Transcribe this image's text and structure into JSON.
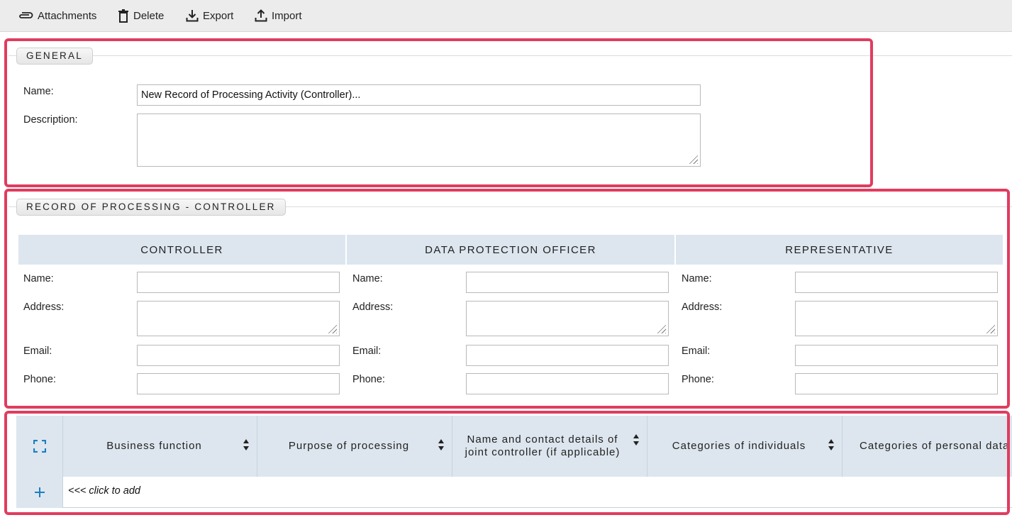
{
  "toolbar": {
    "attachments": "Attachments",
    "delete": "Delete",
    "export": "Export",
    "import": "Import"
  },
  "general": {
    "legend": "GENERAL",
    "name_label": "Name:",
    "name_value": "New Record of Processing Activity (Controller)...",
    "description_label": "Description:",
    "description_value": ""
  },
  "record": {
    "legend": "RECORD OF PROCESSING - CONTROLLER",
    "columns": [
      {
        "title": "CONTROLLER",
        "name_label": "Name:",
        "address_label": "Address:",
        "email_label": "Email:",
        "phone_label": "Phone:"
      },
      {
        "title": "DATA PROTECTION OFFICER",
        "name_label": "Name:",
        "address_label": "Address:",
        "email_label": "Email:",
        "phone_label": "Phone:"
      },
      {
        "title": "REPRESENTATIVE",
        "name_label": "Name:",
        "address_label": "Address:",
        "email_label": "Email:",
        "phone_label": "Phone:"
      }
    ]
  },
  "grid": {
    "headers": [
      "Business function",
      "Purpose of processing",
      "Name and contact details of joint controller (if applicable)",
      "Categories of individuals",
      "Categories of personal data"
    ],
    "add_hint": "<<< click to add"
  },
  "colors": {
    "highlight": "#e03c5f",
    "header_bg": "#dde6ee",
    "accent_blue": "#1b7ec2"
  }
}
